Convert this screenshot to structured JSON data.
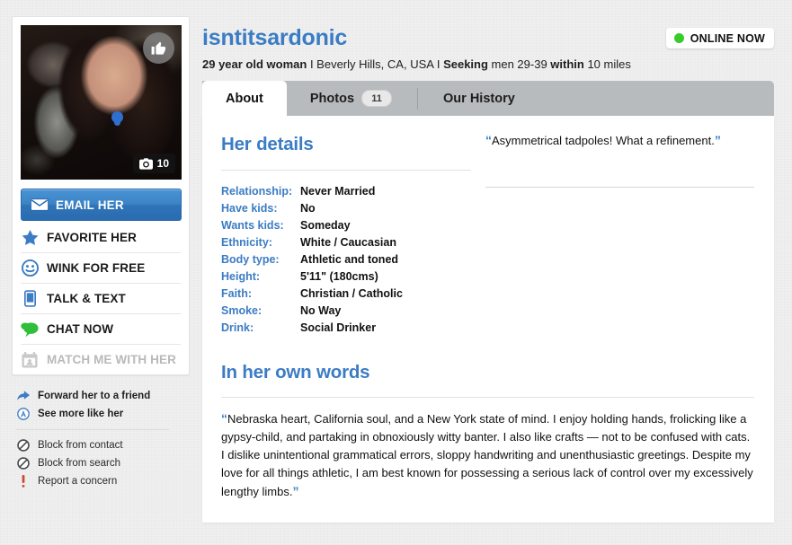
{
  "profile": {
    "username": "isntitsardonic",
    "age_gender": "29 year old woman",
    "sep1": " I ",
    "location": "Beverly Hills, CA, USA",
    "sep2": " I ",
    "seeking_label": "Seeking",
    "seeking_value": " men 29-39 ",
    "within_label": "within",
    "within_value": " 10 miles",
    "online_status": "ONLINE NOW",
    "photo_count": "10",
    "thumbs_up_icon": "thumbs-up-icon",
    "camera_icon": "camera-icon"
  },
  "actions": {
    "email": {
      "label": "EMAIL HER",
      "icon": "envelope-icon"
    },
    "items": [
      {
        "label": "FAVORITE HER",
        "icon": "star-icon",
        "disabled": false
      },
      {
        "label": "WINK FOR FREE",
        "icon": "wink-face-icon",
        "disabled": false
      },
      {
        "label": "TALK & TEXT",
        "icon": "phone-icon",
        "disabled": false
      },
      {
        "label": "CHAT NOW",
        "icon": "chat-bubble-icon",
        "disabled": false
      },
      {
        "label": "MATCH ME WITH HER",
        "icon": "calendar-match-icon",
        "disabled": true
      }
    ]
  },
  "links": {
    "primary": [
      {
        "label": "Forward her to a friend",
        "icon": "forward-arrow-icon"
      },
      {
        "label": "See more like her",
        "icon": "circle-a-icon"
      }
    ],
    "secondary": [
      {
        "label": "Block from contact",
        "icon": "block-icon"
      },
      {
        "label": "Block from search",
        "icon": "block-icon"
      },
      {
        "label": "Report a concern",
        "icon": "exclamation-icon"
      }
    ]
  },
  "tabs": [
    {
      "label": "About",
      "count": null,
      "active": true
    },
    {
      "label": "Photos",
      "count": "11",
      "active": false
    },
    {
      "label": "Our History",
      "count": null,
      "active": false
    }
  ],
  "about": {
    "details_title": "Her details",
    "details": [
      {
        "label": "Relationship:",
        "value": "Never Married"
      },
      {
        "label": "Have kids:",
        "value": "No"
      },
      {
        "label": "Wants kids:",
        "value": "Someday"
      },
      {
        "label": "Ethnicity:",
        "value": "White / Caucasian"
      },
      {
        "label": "Body type:",
        "value": "Athletic and toned"
      },
      {
        "label": "Height:",
        "value": "5'11\" (180cms)"
      },
      {
        "label": "Faith:",
        "value": "Christian / Catholic"
      },
      {
        "label": "Smoke:",
        "value": "No Way"
      },
      {
        "label": "Drink:",
        "value": "Social Drinker"
      }
    ],
    "headline_quote": "Asymmetrical tadpoles! What a refinement.",
    "words_title": "In her own words",
    "bio": "Nebraska heart, California soul, and a New York state of mind. I enjoy holding hands, frolicking like a gypsy-child, and partaking in obnoxiously witty banter. I also like crafts — not to be confused with cats. I dislike unintentional grammatical errors, sloppy handwriting and unenthusiastic greetings. Despite my love for all things athletic, I am best known for possessing a serious lack of control over my excessively lengthy limbs.",
    "open_quote": "“",
    "close_quote": "”"
  },
  "colors": {
    "accent_blue": "#3b7cc4",
    "online_green": "#37cc2b",
    "tabbar_grey": "#b8bbbd",
    "page_bg": "#efefef"
  }
}
